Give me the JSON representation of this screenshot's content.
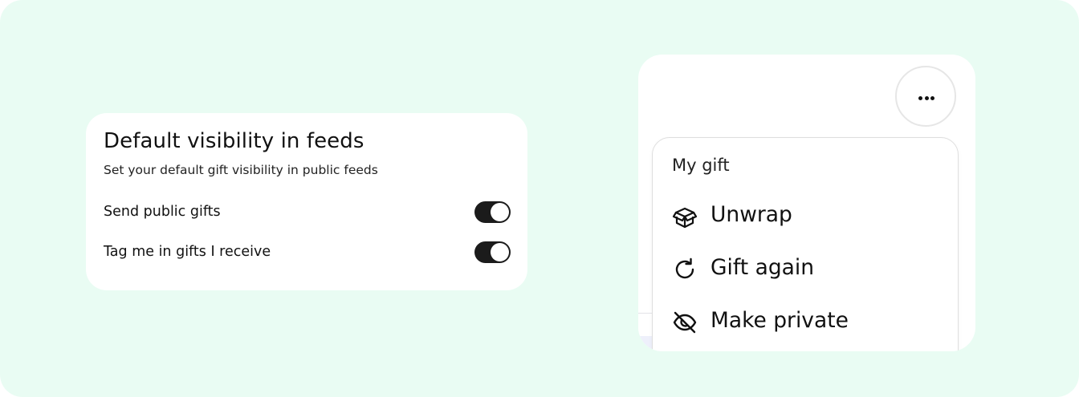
{
  "settings": {
    "title": "Default visibility in feeds",
    "subtitle": "Set your default gift visibility in public feeds",
    "options": [
      {
        "label": "Send public gifts",
        "enabled": true
      },
      {
        "label": "Tag me in gifts I receive",
        "enabled": true
      }
    ]
  },
  "menu": {
    "trigger_icon": "more-horizontal-icon",
    "header": "My gift",
    "items": [
      {
        "label": "Unwrap",
        "icon": "gift-box-icon"
      },
      {
        "label": "Gift again",
        "icon": "refresh-icon"
      },
      {
        "label": "Make private",
        "icon": "eye-off-icon"
      }
    ]
  },
  "colors": {
    "background": "#e9fcf3",
    "card": "#ffffff",
    "toggle_on": "#1b1b1b",
    "text": "#111111"
  }
}
